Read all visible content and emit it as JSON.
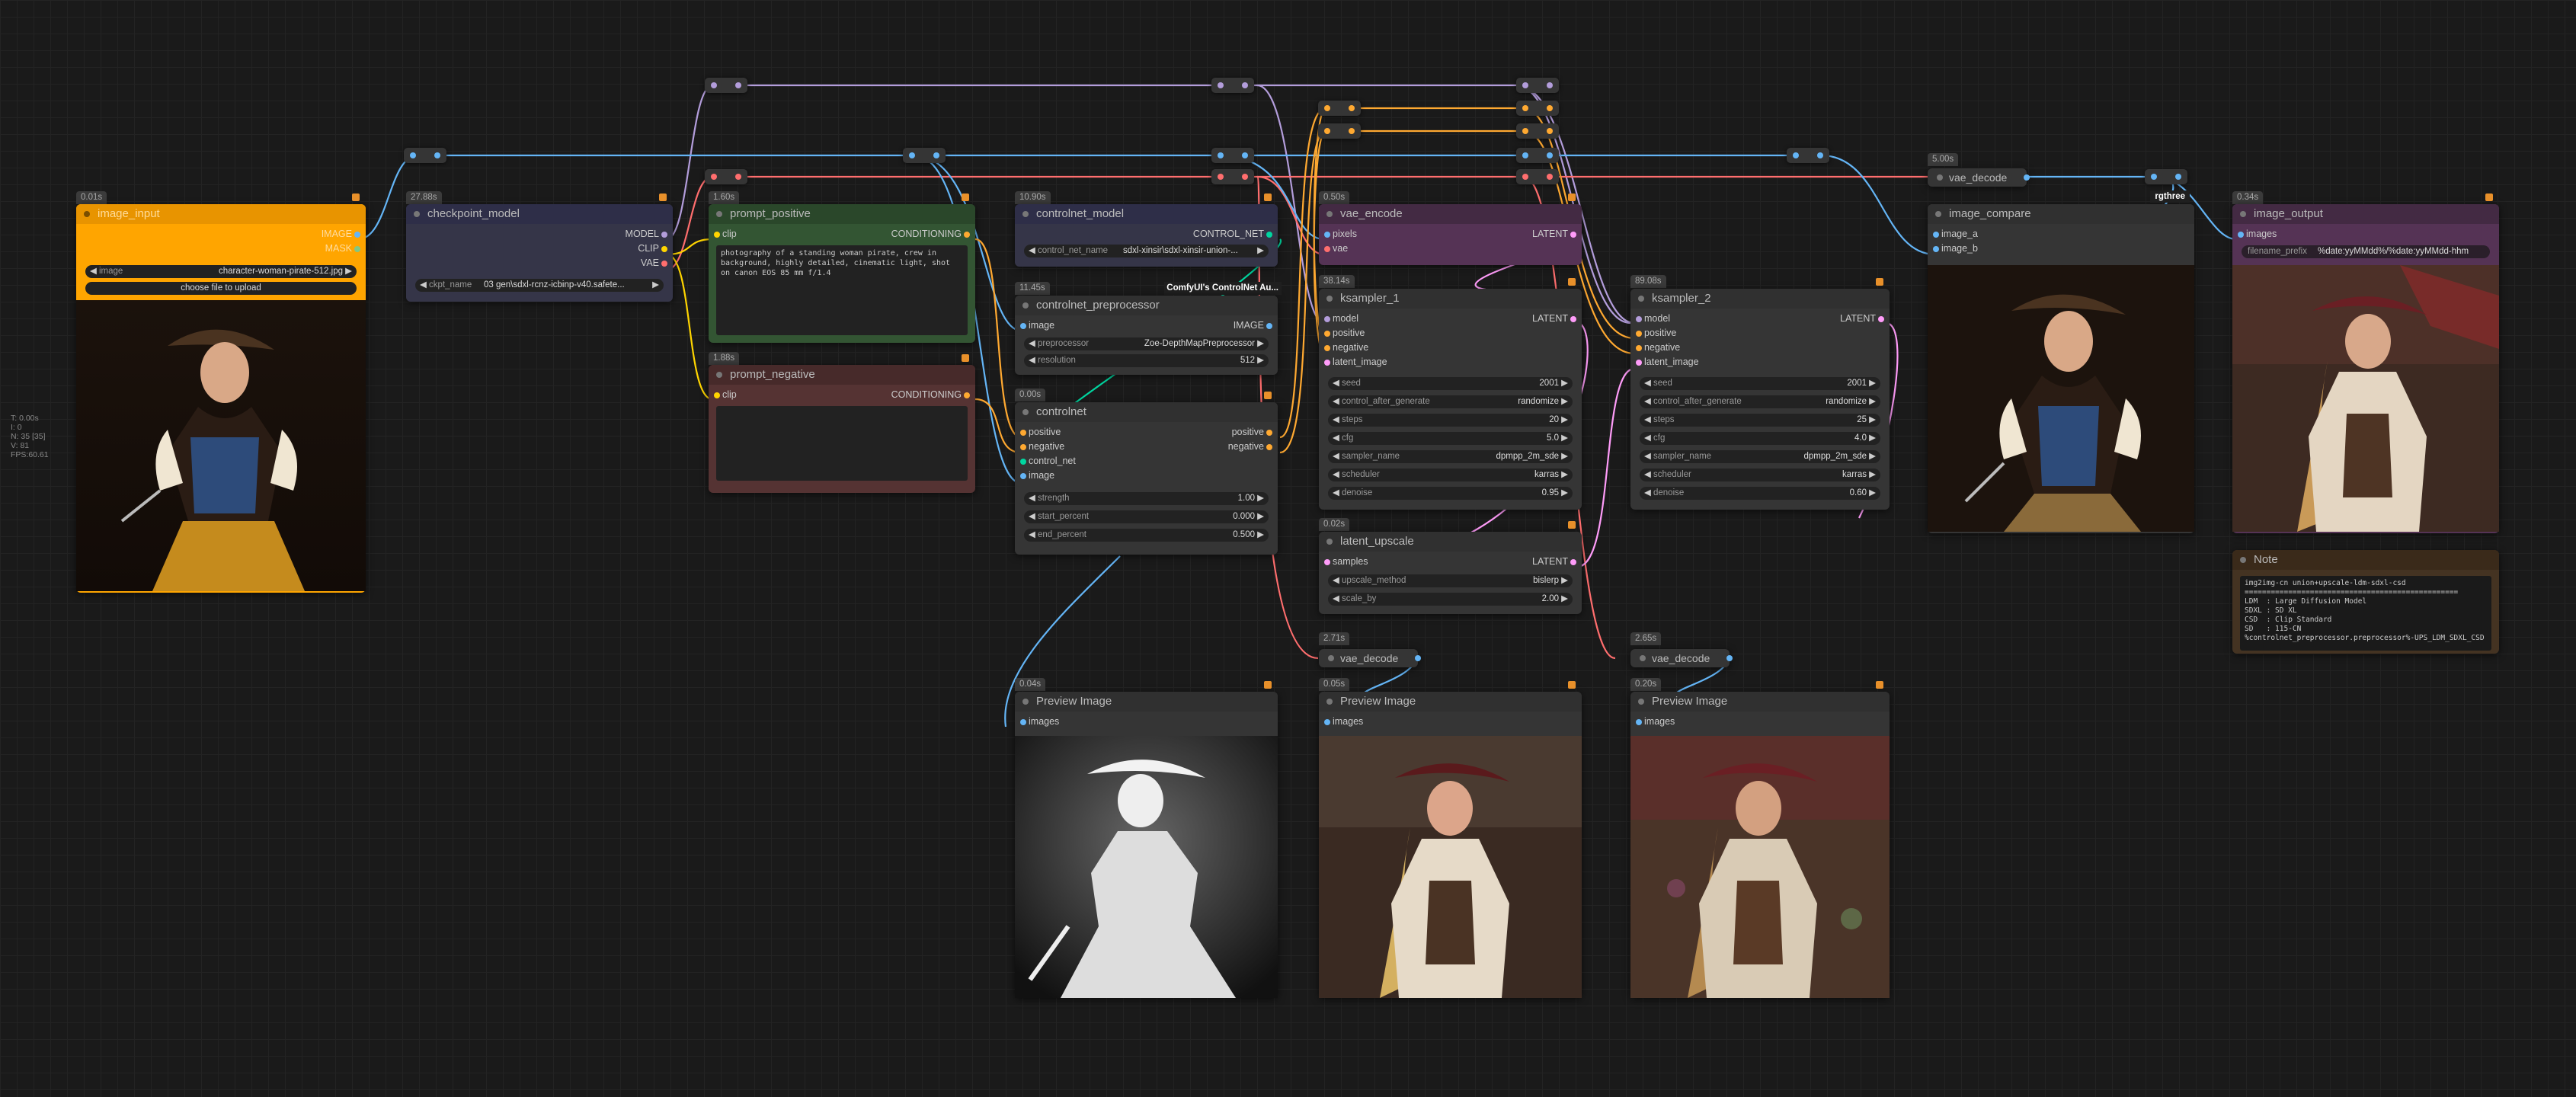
{
  "stats": {
    "lines": [
      "T: 0.00s",
      "I: 0",
      "N: 35 [35]",
      "V: 81",
      "FPS:60.61"
    ]
  },
  "groups": {
    "rgthree": "rgthree",
    "controlnet_aux": "ComfyUI's ControlNet Au..."
  },
  "nodes": {
    "image_input": {
      "timing": "0.01s",
      "title": "image_input",
      "outputs": [
        "IMAGE",
        "MASK"
      ],
      "image_label": "image",
      "image_value": "character-woman-pirate-512.jpg",
      "upload_label": "choose file to upload"
    },
    "checkpoint_model": {
      "timing": "27.88s",
      "title": "checkpoint_model",
      "outputs": [
        "MODEL",
        "CLIP",
        "VAE"
      ],
      "ckpt_label": "ckpt_name",
      "ckpt_value": "03 gen\\sdxl-rcnz-icbinp-v40.safete..."
    },
    "prompt_positive": {
      "timing": "1.60s",
      "title": "prompt_positive",
      "input": "clip",
      "output": "CONDITIONING",
      "text": "photography of a standing woman pirate, crew in background, highly detailed, cinematic light, shot on canon EOS 85 mm f/1.4"
    },
    "prompt_negative": {
      "timing": "1.88s",
      "title": "prompt_negative",
      "input": "clip",
      "output": "CONDITIONING",
      "text": ""
    },
    "controlnet_model": {
      "timing": "10.90s",
      "title": "controlnet_model",
      "output": "CONTROL_NET",
      "name_label": "control_net_name",
      "name_value": "sdxl-xinsir\\sdxl-xinsir-union-..."
    },
    "controlnet_preprocessor": {
      "timing": "11.45s",
      "title": "controlnet_preprocessor",
      "input": "image",
      "output": "IMAGE",
      "widgets": [
        {
          "label": "preprocessor",
          "value": "Zoe-DepthMapPreprocessor"
        },
        {
          "label": "resolution",
          "value": "512"
        }
      ]
    },
    "controlnet": {
      "timing": "0.00s",
      "title": "controlnet",
      "inputs": [
        "positive",
        "negative",
        "control_net",
        "image"
      ],
      "outputs": [
        "positive",
        "negative"
      ],
      "widgets": [
        {
          "label": "strength",
          "value": "1.00"
        },
        {
          "label": "start_percent",
          "value": "0.000"
        },
        {
          "label": "end_percent",
          "value": "0.500"
        }
      ]
    },
    "vae_encode": {
      "timing": "0.50s",
      "title": "vae_encode",
      "inputs": [
        "pixels",
        "vae"
      ],
      "output": "LATENT"
    },
    "ksampler_1": {
      "timing": "38.14s",
      "title": "ksampler_1",
      "inputs": [
        "model",
        "positive",
        "negative",
        "latent_image"
      ],
      "output": "LATENT",
      "widgets": [
        {
          "label": "seed",
          "value": "2001"
        },
        {
          "label": "control_after_generate",
          "value": "randomize"
        },
        {
          "label": "steps",
          "value": "20"
        },
        {
          "label": "cfg",
          "value": "5.0"
        },
        {
          "label": "sampler_name",
          "value": "dpmpp_2m_sde"
        },
        {
          "label": "scheduler",
          "value": "karras"
        },
        {
          "label": "denoise",
          "value": "0.95"
        }
      ]
    },
    "ksampler_2": {
      "timing": "89.08s",
      "title": "ksampler_2",
      "inputs": [
        "model",
        "positive",
        "negative",
        "latent_image"
      ],
      "output": "LATENT",
      "widgets": [
        {
          "label": "seed",
          "value": "2001"
        },
        {
          "label": "control_after_generate",
          "value": "randomize"
        },
        {
          "label": "steps",
          "value": "25"
        },
        {
          "label": "cfg",
          "value": "4.0"
        },
        {
          "label": "sampler_name",
          "value": "dpmpp_2m_sde"
        },
        {
          "label": "scheduler",
          "value": "karras"
        },
        {
          "label": "denoise",
          "value": "0.60"
        }
      ]
    },
    "latent_upscale": {
      "timing": "0.02s",
      "title": "latent_upscale",
      "input": "samples",
      "output": "LATENT",
      "widgets": [
        {
          "label": "upscale_method",
          "value": "bislerp"
        },
        {
          "label": "scale_by",
          "value": "2.00"
        }
      ]
    },
    "vae_decode_1": {
      "timing": "2.71s",
      "title": "vae_decode"
    },
    "vae_decode_2": {
      "timing": "2.65s",
      "title": "vae_decode"
    },
    "vae_decode_3": {
      "timing": "5.00s",
      "title": "vae_decode"
    },
    "preview_1": {
      "timing": "0.04s",
      "title": "Preview Image",
      "input": "images"
    },
    "preview_2": {
      "timing": "0.05s",
      "title": "Preview Image",
      "input": "images"
    },
    "preview_3": {
      "timing": "0.20s",
      "title": "Preview Image",
      "input": "images"
    },
    "image_compare": {
      "title": "image_compare",
      "inputs": [
        "image_a",
        "image_b"
      ]
    },
    "image_output": {
      "timing": "0.34s",
      "title": "image_output",
      "input": "images",
      "prefix_label": "filename_prefix",
      "prefix_value": "%date:yyMMdd%/%date:yyMMdd-hhm"
    },
    "note": {
      "title": "Note",
      "text": "img2img-cn union+upscale-ldm-sdxl-csd\n=================================================\nLDM  : Large Diffusion Model\nSDXL : SD XL\nCSD  : Clip Standard\nSD   : 115-CN\n%controlnet_preprocessor.preprocessor%-UPS_LDM_SDXL_CSD"
    }
  },
  "colors": {
    "clip": "#ffd500",
    "model": "#b39ddb",
    "vae": "#ff6e6e",
    "image": "#64b5f6",
    "latent": "#ff9cf9",
    "conditioning": "#ffa931",
    "control_net": "#00d6a0",
    "mask": "#81c784"
  }
}
